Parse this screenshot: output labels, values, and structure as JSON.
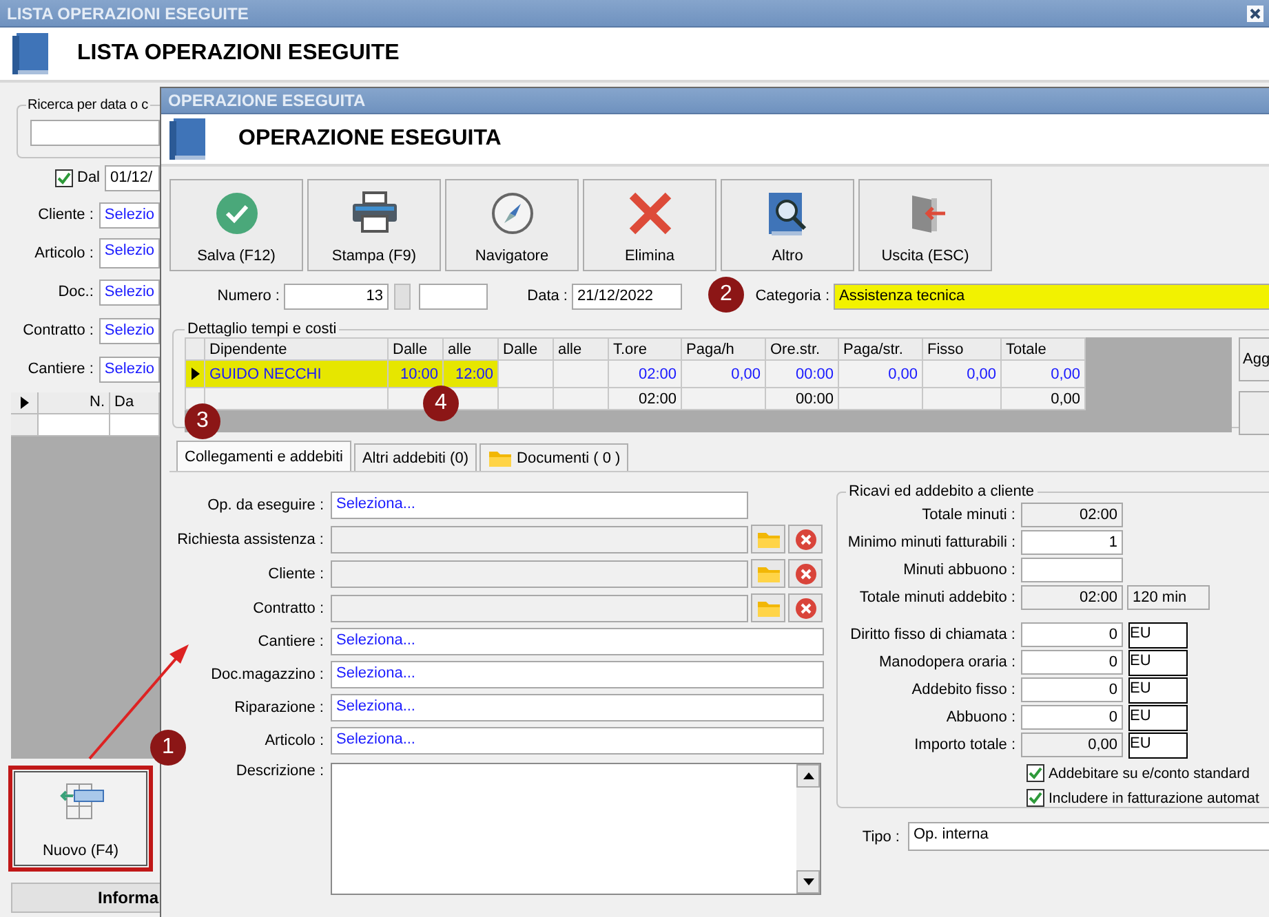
{
  "back_window": {
    "title": "LISTA OPERAZIONI ESEGUITE",
    "heading": "LISTA OPERAZIONI ESEGUITE",
    "search_group": {
      "title": "Ricerca per data o c"
    },
    "date_filter": {
      "label": "Dal",
      "checked": true,
      "value": "01/12/"
    },
    "filters": [
      {
        "label": "Cliente :",
        "value": "Selezio"
      },
      {
        "label": "Articolo :",
        "value": "Selezio"
      },
      {
        "label": "Doc.:",
        "value": "Selezio"
      },
      {
        "label": "Contratto :",
        "value": "Selezio"
      },
      {
        "label": "Cantiere :",
        "value": "Selezio"
      }
    ],
    "list": {
      "columns": [
        "N.",
        "Da"
      ]
    },
    "new_button": {
      "label": "Nuovo (F4)"
    },
    "info_button": {
      "label": "Informa"
    }
  },
  "dialog": {
    "title": "OPERAZIONE ESEGUITA",
    "heading": "OPERAZIONE ESEGUITA",
    "toolbar": [
      {
        "label": "Salva (F12)"
      },
      {
        "label": "Stampa (F9)"
      },
      {
        "label": "Navigatore"
      },
      {
        "label": "Elimina"
      },
      {
        "label": "Altro"
      },
      {
        "label": "Uscita (ESC)"
      }
    ],
    "numero": {
      "label": "Numero :",
      "value": "13"
    },
    "data": {
      "label": "Data :",
      "value": "21/12/2022"
    },
    "categoria": {
      "label": "Categoria :",
      "value": "Assistenza tecnica"
    },
    "detail": {
      "title": "Dettaglio tempi e costi",
      "columns": [
        "Dipendente",
        "Dalle",
        "alle",
        "Dalle",
        "alle",
        "T.ore",
        "Paga/h",
        "Ore.str.",
        "Paga/str.",
        "Fisso",
        "Totale"
      ],
      "rows": [
        {
          "selected": true,
          "cells": [
            "GUIDO NECCHI",
            "10:00",
            "12:00",
            null,
            null,
            "02:00",
            "0,00",
            "00:00",
            "0,00",
            "0,00",
            "0,00"
          ]
        },
        {
          "selected": false,
          "cells": [
            null,
            null,
            null,
            null,
            null,
            "02:00",
            null,
            "00:00",
            null,
            null,
            "0,00"
          ]
        }
      ],
      "side_button": "Agg"
    },
    "tabs": [
      {
        "label": "Collegamenti e addebiti",
        "selected": true
      },
      {
        "label": "Altri addebiti (0)",
        "selected": false
      },
      {
        "label": "Documenti ( 0 )",
        "selected": false
      }
    ],
    "form": [
      {
        "label": "Op. da eseguire :",
        "kind": "select",
        "value": "Seleziona..."
      },
      {
        "label": "Richiesta assistenza :",
        "kind": "lookup"
      },
      {
        "label": "Cliente :",
        "kind": "lookup"
      },
      {
        "label": "Contratto :",
        "kind": "lookup"
      },
      {
        "label": "Cantiere :",
        "kind": "select",
        "value": "Seleziona..."
      },
      {
        "label": "Doc.magazzino :",
        "kind": "select",
        "value": "Seleziona..."
      },
      {
        "label": "Riparazione :",
        "kind": "select",
        "value": "Seleziona..."
      },
      {
        "label": "Articolo :",
        "kind": "select",
        "value": "Seleziona..."
      },
      {
        "label": "Descrizione :",
        "kind": "memo"
      }
    ],
    "charges": {
      "title": "Ricavi ed addebito a cliente",
      "rows": [
        {
          "label": "Totale minuti :",
          "value": "02:00",
          "readonly": true
        },
        {
          "label": "Minimo minuti fatturabili :",
          "value": "1",
          "readonly": false
        },
        {
          "label": "Minuti abbuono :",
          "readonly": false
        },
        {
          "label": "Totale minuti addebito :",
          "value": "02:00",
          "readonly": true,
          "extra": "120 min"
        },
        {
          "label": "Diritto fisso di chiamata :",
          "value": "0",
          "readonly": false,
          "unit": "EU"
        },
        {
          "label": "Manodopera oraria :",
          "value": "0",
          "readonly": false,
          "unit": "EU"
        },
        {
          "label": "Addebito fisso :",
          "value": "0",
          "readonly": false,
          "unit": "EU"
        },
        {
          "label": "Abbuono :",
          "value": "0",
          "readonly": false,
          "unit": "EU"
        },
        {
          "label": "Importo totale :",
          "value": "0,00",
          "readonly": true,
          "unit": "EU"
        }
      ],
      "checks": [
        {
          "label": "Addebitare su e/conto standard",
          "checked": true
        },
        {
          "label": "Includere in fatturazione automat",
          "checked": true
        }
      ]
    },
    "tipo": {
      "label": "Tipo :",
      "value": "Op. interna"
    }
  },
  "callouts": [
    {
      "number": "1"
    },
    {
      "number": "2"
    },
    {
      "number": "3"
    },
    {
      "number": "4"
    }
  ]
}
